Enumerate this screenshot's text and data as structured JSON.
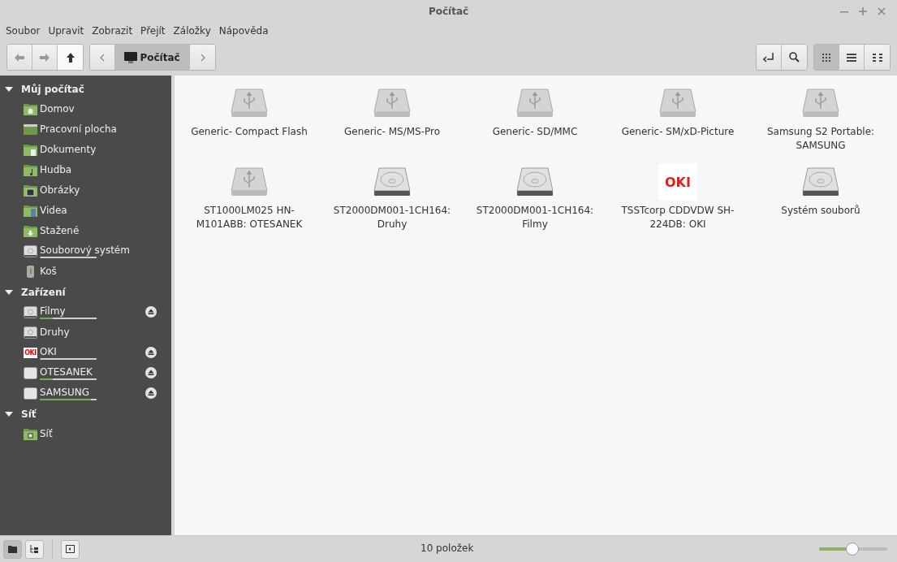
{
  "window": {
    "title": "Počítač"
  },
  "menu": [
    "Soubor",
    "Upravit",
    "Zobrazit",
    "Přejít",
    "Záložky",
    "Nápověda"
  ],
  "breadcrumb": {
    "label": "Počítač",
    "selected": true
  },
  "view_buttons": [
    {
      "kind": "icons",
      "selected": true
    },
    {
      "kind": "list",
      "selected": false
    },
    {
      "kind": "compact",
      "selected": false
    }
  ],
  "sidebar": [
    {
      "title": "Můj počítač",
      "expanded": true,
      "items": [
        {
          "label": "Domov",
          "kind": "home"
        },
        {
          "label": "Pracovní plocha",
          "kind": "desktop"
        },
        {
          "label": "Dokumenty",
          "kind": "documents"
        },
        {
          "label": "Hudba",
          "kind": "music"
        },
        {
          "label": "Obrázky",
          "kind": "pictures"
        },
        {
          "label": "Videa",
          "kind": "videos"
        },
        {
          "label": "Stažené",
          "kind": "downloads"
        },
        {
          "label": "Souborový systém",
          "kind": "disk",
          "level": 0.02
        },
        {
          "label": "Koš",
          "kind": "trash"
        }
      ]
    },
    {
      "title": "Zařízení",
      "expanded": true,
      "items": [
        {
          "label": "Filmy",
          "kind": "disk",
          "level": 0.23,
          "eject": true
        },
        {
          "label": "Druhy",
          "kind": "disk",
          "eject": false
        },
        {
          "label": "OKI",
          "kind": "logo",
          "logo": "OKI",
          "level": 0.02,
          "eject": true
        },
        {
          "label": "OTESANEK",
          "kind": "removable",
          "level": 0.23,
          "eject": true
        },
        {
          "label": "SAMSUNG",
          "kind": "removable",
          "level": 0.9,
          "eject": true
        }
      ]
    },
    {
      "title": "Síť",
      "expanded": true,
      "items": [
        {
          "label": "Síť",
          "kind": "network"
        }
      ]
    }
  ],
  "files": [
    {
      "label": "Generic- Compact Flash",
      "kind": "usb"
    },
    {
      "label": "Generic- MS/MS-Pro",
      "kind": "usb"
    },
    {
      "label": "Generic- SD/MMC",
      "kind": "usb"
    },
    {
      "label": "Generic- SM/xD-Picture",
      "kind": "usb"
    },
    {
      "label": "Samsung S2 Portable: SAMSUNG",
      "kind": "usb"
    },
    {
      "label": "ST1000LM025 HN-M101ABB: OTESANEK",
      "kind": "usb"
    },
    {
      "label": "ST2000DM001-1CH164: Druhy",
      "kind": "hdd"
    },
    {
      "label": "ST2000DM001-1CH164: Filmy",
      "kind": "hdd"
    },
    {
      "label": "TSSTcorp CDDVDW SH-224DB: OKI",
      "kind": "logo",
      "logo": "OKI"
    },
    {
      "label": "Systém souborů",
      "kind": "hdd"
    }
  ],
  "status_bar": {
    "pane_buttons": [
      {
        "kind": "places",
        "selected": true
      },
      {
        "kind": "tree",
        "selected": false
      }
    ],
    "text": "10 položek",
    "zoom": {
      "level": 0.49
    }
  }
}
